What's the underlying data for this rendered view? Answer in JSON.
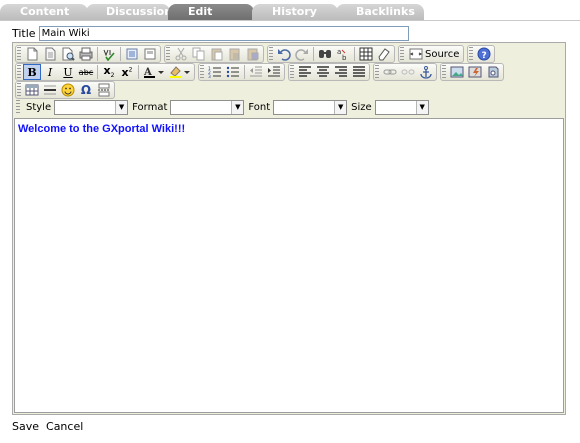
{
  "tabs": [
    {
      "label": "Content",
      "active": false
    },
    {
      "label": "Discussion",
      "active": false
    },
    {
      "label": "Edit",
      "active": true
    },
    {
      "label": "History",
      "active": false
    },
    {
      "label": "Backlinks",
      "active": false
    }
  ],
  "title": {
    "label": "Title",
    "value": "Main Wiki"
  },
  "toolbar": {
    "source_label": "Source",
    "row1_icons": [
      "new-page-icon",
      "save-template-icon",
      "preview-icon",
      "print-icon",
      "spellcheck-icon",
      "select-all-icon",
      "templates-icon",
      "cut-icon",
      "copy-icon",
      "paste-icon",
      "paste-text-icon",
      "paste-word-icon",
      "undo-icon",
      "redo-icon",
      "find-icon",
      "replace-icon",
      "table-icon",
      "eraser-icon",
      "source-icon",
      "help-icon"
    ],
    "row2_icons": [
      "bold-icon",
      "italic-icon",
      "underline-icon",
      "strikethrough-icon",
      "subscript-icon",
      "superscript-icon",
      "text-color-icon",
      "bg-color-icon",
      "numbered-list-icon",
      "bulleted-list-icon",
      "outdent-icon",
      "indent-icon",
      "align-left-icon",
      "align-center-icon",
      "align-right-icon",
      "justify-icon",
      "link-icon",
      "unlink-icon",
      "anchor-icon",
      "image-icon",
      "flash-icon",
      "box-icon"
    ],
    "row3_icons": [
      "table-small-icon",
      "horizontal-rule-icon",
      "smiley-icon",
      "omega-icon",
      "page-break-icon"
    ],
    "text_glyphs": {
      "bold": "B",
      "italic": "I",
      "underline": "U",
      "strike": "abc",
      "subscript": "x",
      "superscript": "x",
      "subscript_mark": "2",
      "superscript_mark": "2",
      "omega": "Ω",
      "text_color": "A"
    },
    "combos": [
      {
        "label": "Style",
        "value": ""
      },
      {
        "label": "Format",
        "value": ""
      },
      {
        "label": "Font",
        "value": ""
      },
      {
        "label": "Size",
        "value": ""
      }
    ]
  },
  "content": {
    "text": "Welcome to the GXportal Wiki!!!",
    "color": "#1212ff"
  },
  "actions": {
    "save": "Save",
    "cancel": "Cancel"
  }
}
